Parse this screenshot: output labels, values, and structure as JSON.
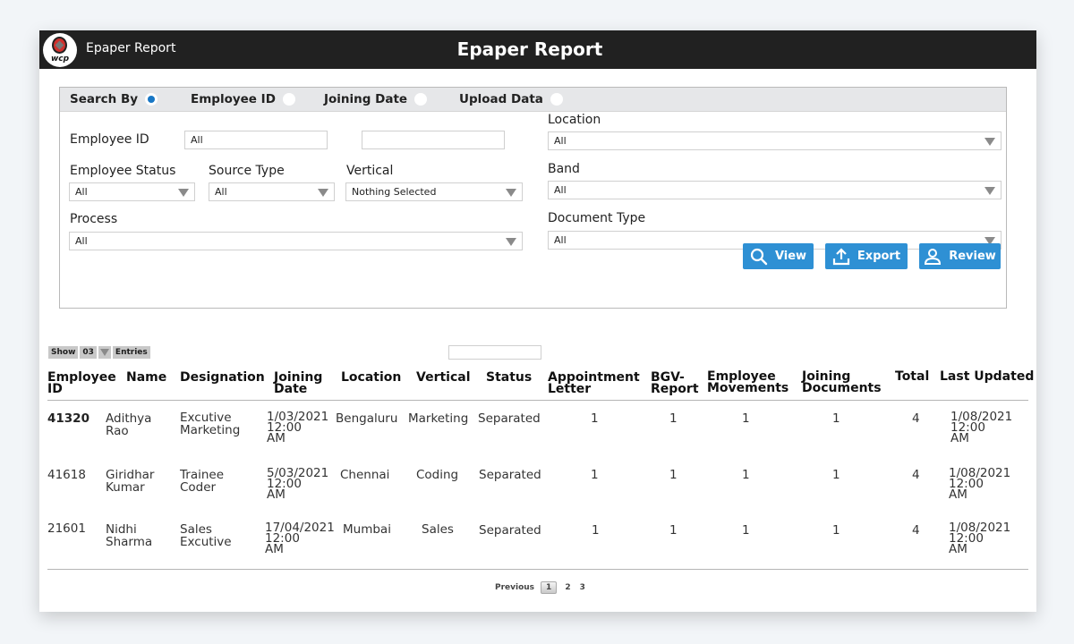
{
  "header": {
    "logo_text": "wcp",
    "app_title": "Epaper Report",
    "page_title": "Epaper Report"
  },
  "search_by": {
    "label": "Search By",
    "options": [
      {
        "label": "Employee ID",
        "selected": false
      },
      {
        "label": "Joining Date",
        "selected": false
      },
      {
        "label": "Upload Data",
        "selected": false
      }
    ],
    "search_by_selected": true
  },
  "filters": {
    "employee_id": {
      "label": "Employee ID",
      "value_from": "All",
      "value_to": ""
    },
    "employee_status": {
      "label": "Employee Status",
      "value": "All"
    },
    "source_type": {
      "label": "Source Type",
      "value": "All"
    },
    "vertical": {
      "label": "Vertical",
      "value": "Nothing Selected"
    },
    "process": {
      "label": "Process",
      "value": "All"
    },
    "location": {
      "label": "Location",
      "value": "All"
    },
    "band": {
      "label": "Band",
      "value": "All"
    },
    "document_type": {
      "label": "Document Type",
      "value": "All"
    }
  },
  "actions": {
    "view": "View",
    "export": "Export",
    "review": "Review"
  },
  "table_controls": {
    "show_label": "Show",
    "entries_value": "03",
    "entries_label": "Entries",
    "search_value": ""
  },
  "table": {
    "columns": [
      {
        "l1": "Employee",
        "l2": "ID"
      },
      {
        "l1": "Name",
        "l2": ""
      },
      {
        "l1": "Designation",
        "l2": ""
      },
      {
        "l1": "Joining",
        "l2": "Date"
      },
      {
        "l1": "Location",
        "l2": ""
      },
      {
        "l1": "Vertical",
        "l2": ""
      },
      {
        "l1": "Status",
        "l2": ""
      },
      {
        "l1": "Appointment",
        "l2": "Letter"
      },
      {
        "l1": "BGV-",
        "l2": "Report"
      },
      {
        "l1": "Employee",
        "l2": "Movements"
      },
      {
        "l1": "Joining",
        "l2": "Documents"
      },
      {
        "l1": "Total",
        "l2": ""
      },
      {
        "l1": "Last Updated",
        "l2": ""
      }
    ],
    "rows": [
      {
        "employee_id": "41320",
        "name": [
          "Adithya",
          "Rao"
        ],
        "designation": [
          "Excutive",
          "Marketing"
        ],
        "joining_date": [
          "1/03/2021",
          "12:00",
          "AM"
        ],
        "location": "Bengaluru",
        "vertical": "Marketing",
        "status": "Separated",
        "appointment_letter": "1",
        "bgv_report": "1",
        "employee_movements": "1",
        "joining_documents": "1",
        "total": "4",
        "last_updated": [
          "1/08/2021",
          "12:00",
          "AM"
        ]
      },
      {
        "employee_id": "41618",
        "name": [
          "Giridhar",
          "Kumar"
        ],
        "designation": [
          "Trainee",
          "Coder"
        ],
        "joining_date": [
          "5/03/2021",
          "12:00",
          "AM"
        ],
        "location": "Chennai",
        "vertical": "Coding",
        "status": "Separated",
        "appointment_letter": "1",
        "bgv_report": "1",
        "employee_movements": "1",
        "joining_documents": "1",
        "total": "4",
        "last_updated": [
          "1/08/2021",
          "12:00",
          "AM"
        ]
      },
      {
        "employee_id": "21601",
        "name": [
          "Nidhi",
          "Sharma"
        ],
        "designation": [
          "Sales",
          "Excutive"
        ],
        "joining_date": [
          "17/04/2021",
          "12:00",
          "AM"
        ],
        "location": "Mumbai",
        "vertical": "Sales",
        "status": "Separated",
        "appointment_letter": "1",
        "bgv_report": "1",
        "employee_movements": "1",
        "joining_documents": "1",
        "total": "4",
        "last_updated": [
          "1/08/2021",
          "12:00",
          "AM"
        ]
      }
    ]
  },
  "pagination": {
    "previous": "Previous",
    "pages": [
      "1",
      "2",
      "3"
    ],
    "current": "1"
  },
  "colors": {
    "header_bg": "#212121",
    "accent_blue": "#2e90d4",
    "radio_selected": "#1877c5"
  }
}
